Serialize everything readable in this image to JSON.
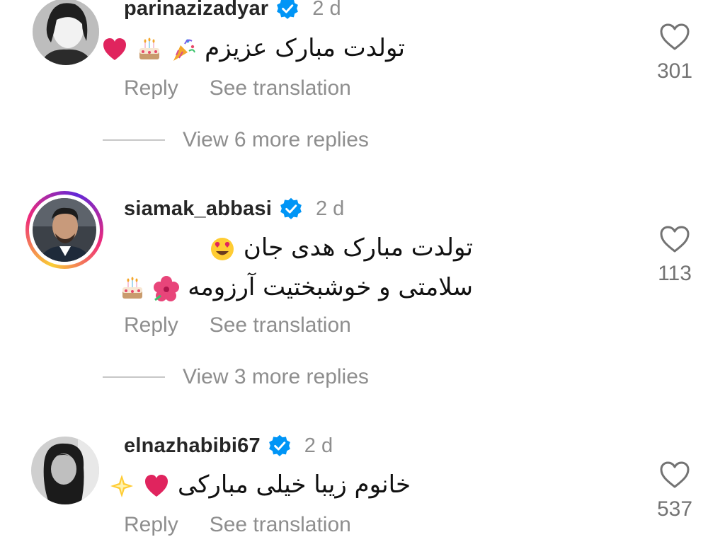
{
  "comments": [
    {
      "username": "parinazizadyar",
      "time": "2 d",
      "text_lines": [
        "تولدت مبارک عزیزم"
      ],
      "emoji_names": [
        "party-popper-emoji",
        "birthday-cake-emoji",
        "red-heart-emoji"
      ],
      "reply_label": "Reply",
      "translate_label": "See translation",
      "like_count": "301",
      "view_replies": "View 6 more replies"
    },
    {
      "username": "siamak_abbasi",
      "time": "2 d",
      "text_lines": [
        "تولدت مبارک هدی جان",
        "سلامتی و خوشبختیت آرزومه"
      ],
      "emoji_names": [
        "heart-eyes-emoji",
        "hibiscus-emoji",
        "birthday-cake-emoji"
      ],
      "reply_label": "Reply",
      "translate_label": "See translation",
      "like_count": "113",
      "view_replies": "View 3 more replies"
    },
    {
      "username": "elnazhabibi67",
      "time": "2 d",
      "text_lines": [
        "خانوم زیبا خیلی مبارکی"
      ],
      "emoji_names": [
        "red-heart-emoji",
        "sparkle-star-emoji"
      ],
      "reply_label": "Reply",
      "translate_label": "See translation",
      "like_count": "537"
    }
  ],
  "colors": {
    "verified_blue": "#0095f6",
    "secondary_text": "#8e8e8e",
    "primary_text": "#262626",
    "heart_red": "#e0245e"
  },
  "icons": {
    "verified": "verified-badge-icon",
    "like": "heart-outline-icon"
  }
}
